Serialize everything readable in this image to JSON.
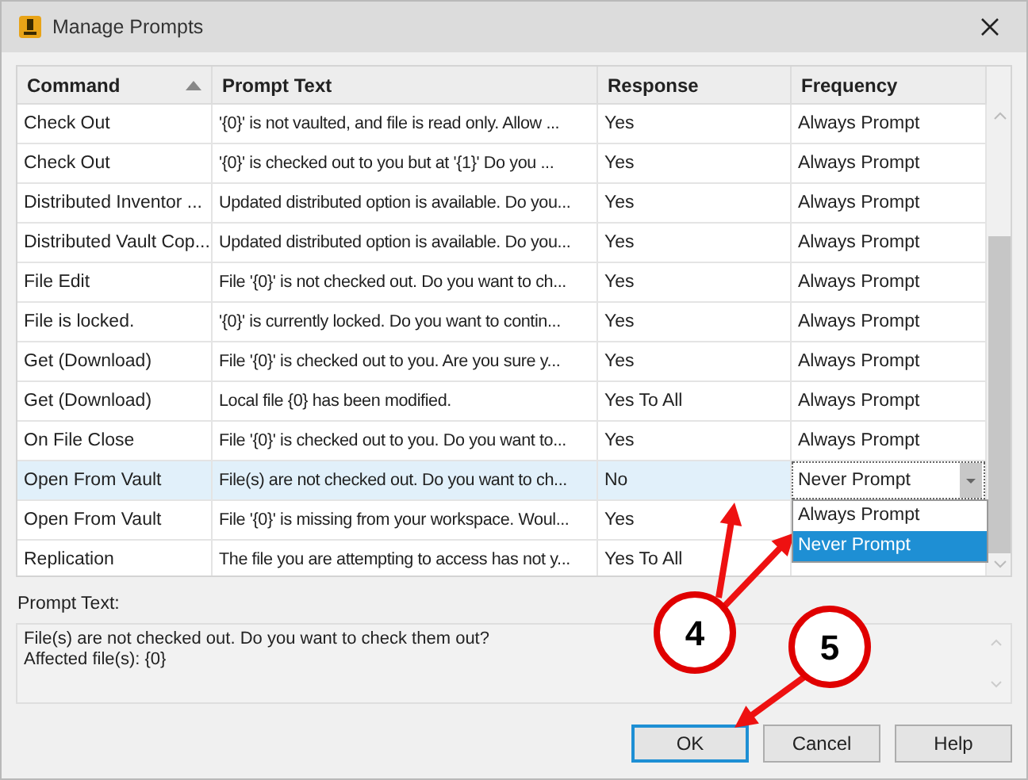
{
  "window": {
    "title": "Manage Prompts"
  },
  "table": {
    "columns": [
      {
        "label": "Command",
        "sort_ascending": true
      },
      {
        "label": "Prompt Text"
      },
      {
        "label": "Response"
      },
      {
        "label": "Frequency"
      }
    ],
    "rows": [
      {
        "command": "Check Out",
        "prompt": "'{0}' is not vaulted, and file is read only.  Allow ...",
        "response": "Yes",
        "frequency": "Always Prompt",
        "selected": false
      },
      {
        "command": "Check Out",
        "prompt": "'{0}' is checked out to you but at '{1}' Do you ...",
        "response": "Yes",
        "frequency": "Always Prompt",
        "selected": false
      },
      {
        "command": "Distributed Inventor ...",
        "prompt": "Updated distributed option is available. Do you...",
        "response": "Yes",
        "frequency": "Always Prompt",
        "selected": false
      },
      {
        "command": "Distributed Vault Cop...",
        "prompt": "Updated distributed option is available. Do you...",
        "response": "Yes",
        "frequency": "Always Prompt",
        "selected": false
      },
      {
        "command": "File Edit",
        "prompt": "File '{0}' is not checked out. Do you want to ch...",
        "response": "Yes",
        "frequency": "Always Prompt",
        "selected": false
      },
      {
        "command": "File is locked.",
        "prompt": "'{0}' is currently locked. Do you want to contin...",
        "response": "Yes",
        "frequency": "Always Prompt",
        "selected": false
      },
      {
        "command": "Get (Download)",
        "prompt": "File '{0}' is checked out to you. Are you sure y...",
        "response": "Yes",
        "frequency": "Always Prompt",
        "selected": false
      },
      {
        "command": "Get (Download)",
        "prompt": "Local file {0} has been modified.",
        "response": "Yes To All",
        "frequency": "Always Prompt",
        "selected": false
      },
      {
        "command": "On File Close",
        "prompt": "File '{0}' is checked out to you. Do you want to...",
        "response": "Yes",
        "frequency": "Always Prompt",
        "selected": false
      },
      {
        "command": "Open From Vault",
        "prompt": "File(s) are not checked out. Do you want to ch...",
        "response": "No",
        "frequency": "Never Prompt",
        "selected": true,
        "dropdown": {
          "options": [
            {
              "label": "Always Prompt",
              "selected": false
            },
            {
              "label": "Never Prompt",
              "selected": true
            }
          ]
        }
      },
      {
        "command": "Open From Vault",
        "prompt": "File '{0}' is missing from your workspace. Woul...",
        "response": "Yes",
        "selected": false
      },
      {
        "command": "Replication",
        "prompt": "The file you are attempting to access has not y...",
        "response": "Yes To All",
        "selected": false
      }
    ]
  },
  "prompt_text": {
    "label": "Prompt Text:",
    "lines": [
      "File(s) are not checked out. Do you want to check them out?",
      "Affected file(s): {0}"
    ]
  },
  "buttons": [
    {
      "label": "OK",
      "default": true
    },
    {
      "label": "Cancel",
      "default": false
    },
    {
      "label": "Help",
      "default": false
    }
  ],
  "callouts": [
    {
      "label": "4"
    },
    {
      "label": "5"
    }
  ]
}
